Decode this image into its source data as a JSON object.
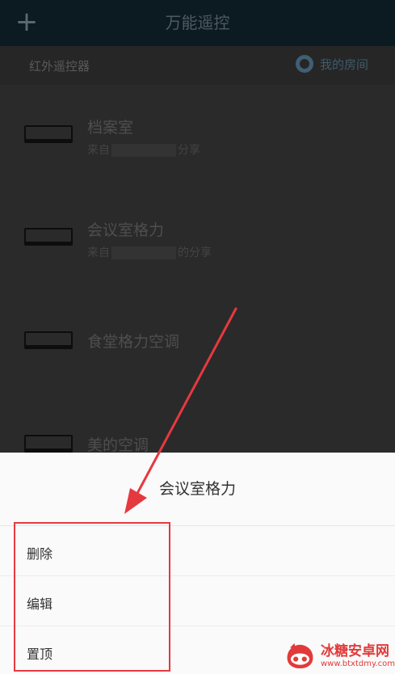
{
  "header": {
    "title": "万能遥控",
    "add_icon": "plus-icon"
  },
  "subbar": {
    "category": "红外遥控器",
    "room_label": "我的房间"
  },
  "devices": [
    {
      "name": "档案室",
      "prefix": "来自",
      "suffix": "分享"
    },
    {
      "name": "会议室格力",
      "prefix": "来自",
      "suffix": "的分享"
    },
    {
      "name": "食堂格力空调",
      "prefix": "",
      "suffix": ""
    },
    {
      "name": "美的空调",
      "prefix": "",
      "suffix": ""
    }
  ],
  "sheet": {
    "title": "会议室格力",
    "items": [
      {
        "label": "删除"
      },
      {
        "label": "编辑"
      },
      {
        "label": "置顶"
      }
    ]
  },
  "watermark": {
    "name": "冰糖安卓网",
    "url": "www.btxtdmy.com"
  },
  "colors": {
    "highlight": "#e53940",
    "topbar": "#0c1a22",
    "sheet_bg": "#fafafa"
  }
}
